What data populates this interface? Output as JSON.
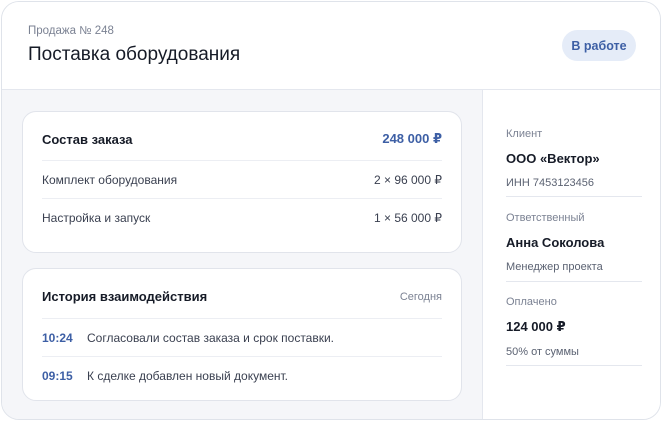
{
  "header": {
    "sale_number": "Продажа № 248",
    "title": "Поставка оборудования",
    "status": "В работе"
  },
  "order": {
    "title": "Состав заказа",
    "total": "248 000 ₽",
    "items": [
      {
        "name": "Комплект оборудования",
        "qty": "2 × 96 000 ₽"
      },
      {
        "name": "Настройка и запуск",
        "qty": "1 × 56 000 ₽"
      }
    ]
  },
  "history": {
    "title": "История взаимодействия",
    "date": "Сегодня",
    "entries": [
      {
        "time": "10:24",
        "text": "Согласовали состав заказа и срок поставки."
      },
      {
        "time": "09:15",
        "text": "К сделке добавлен новый документ."
      }
    ]
  },
  "sidebar": {
    "client": {
      "label": "Клиент",
      "value": "ООО «Вектор»",
      "sub": "ИНН 7453123456"
    },
    "owner": {
      "label": "Ответственный",
      "value": "Анна Соколова",
      "sub": "Менеджер проекта"
    },
    "paid": {
      "label": "Оплачено",
      "value": "124 000 ₽",
      "sub": "50% от суммы"
    }
  },
  "colors": {
    "accent": "#3d5fa5",
    "badge_bg": "#e5ecf8",
    "main_bg": "#f5f6f9"
  }
}
